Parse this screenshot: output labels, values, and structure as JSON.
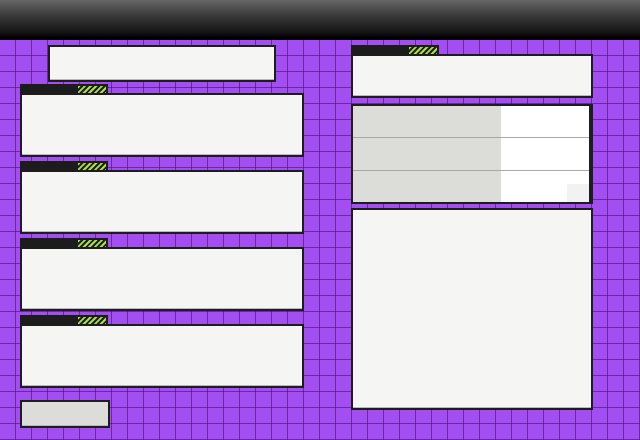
{
  "screen": {
    "title": "",
    "search_text": "",
    "slots": [
      {
        "label": ""
      },
      {
        "label": ""
      },
      {
        "label": ""
      },
      {
        "label": ""
      }
    ],
    "footer_button_label": "",
    "info_box_text": "",
    "stats_rows": [
      {
        "label": "",
        "value": ""
      },
      {
        "label": "",
        "value": ""
      },
      {
        "label": "",
        "value": ""
      }
    ],
    "detail_text": ""
  },
  "colors": {
    "background": "#a24ef0",
    "grid_line": "#3c0a6e",
    "panel_fill": "#f5f5f3",
    "panel_border": "#1d1d1d",
    "tab_fill": "#1c1c1c",
    "tab_stripe": "#a8e23a",
    "stats_label_fill": "#dcdcd8",
    "stats_value_fill": "#ffffff"
  }
}
